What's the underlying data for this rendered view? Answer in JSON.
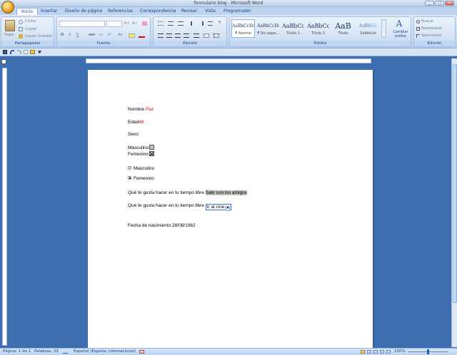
{
  "window": {
    "title": "formulario blog - Microsoft Word"
  },
  "tabs": [
    "Inicio",
    "Insertar",
    "Diseño de página",
    "Referencias",
    "Correspondencia",
    "Revisar",
    "Vista",
    "Programador"
  ],
  "ribbon": {
    "clipboard": {
      "label": "Portapapeles",
      "paste": "Pegar",
      "cut": "Cortar",
      "copy": "Copiar",
      "format_painter": "Copiar formato"
    },
    "font": {
      "label": "Fuente",
      "bold": "N",
      "italic": "K",
      "underline": "S",
      "strike": "abc",
      "subscript": "x₂",
      "superscript": "x²",
      "change_case": "Aa",
      "grow": "A↑",
      "shrink": "A↓"
    },
    "paragraph": {
      "label": "Párrafo",
      "show_marks": "¶"
    },
    "styles": {
      "label": "Estilos",
      "items": [
        {
          "sample": "AaBbCcDc",
          "name": "¶ Normal"
        },
        {
          "sample": "AaBbCcDc",
          "name": "¶ Sin espa..."
        },
        {
          "sample": "AaBbCc",
          "name": "Título 1"
        },
        {
          "sample": "AaBbCc",
          "name": "Título 2"
        },
        {
          "sample": "AaB",
          "name": "Título"
        },
        {
          "sample": "AaBbCc.",
          "name": "Subtítulo"
        }
      ],
      "change_styles": "Cambiar estilos"
    },
    "editing": {
      "label": "Edición",
      "find": "Buscar",
      "replace": "Reemplazar",
      "select": "Seleccionar"
    }
  },
  "document": {
    "name_label": "Nombre",
    "name_value": "Paz",
    "age_label": "Edad",
    "age_value": "48",
    "sex_label": "Sexo",
    "male_check": "Masculino",
    "female_check": "Femenino",
    "radio_male": "Masculino",
    "radio_female": "Femenino",
    "hobby_question": "Qué te gusta hacer en tu tiempo libre",
    "hobby_answer": "Salir con los amigos",
    "hobby_question2": "Qué te gusta hacer en tu tiempo libre",
    "hobby_combo": "Ir al cine",
    "birth_label": "Fecha de nacimiento",
    "birth_value": "28/08/1962"
  },
  "status": {
    "page": "Página: 1 de 1",
    "words": "Palabras: 33",
    "language": "Español (España, internacional)",
    "zoom": "100%"
  },
  "colors": {
    "accent": "#15428b",
    "field_red": "#e00000"
  }
}
